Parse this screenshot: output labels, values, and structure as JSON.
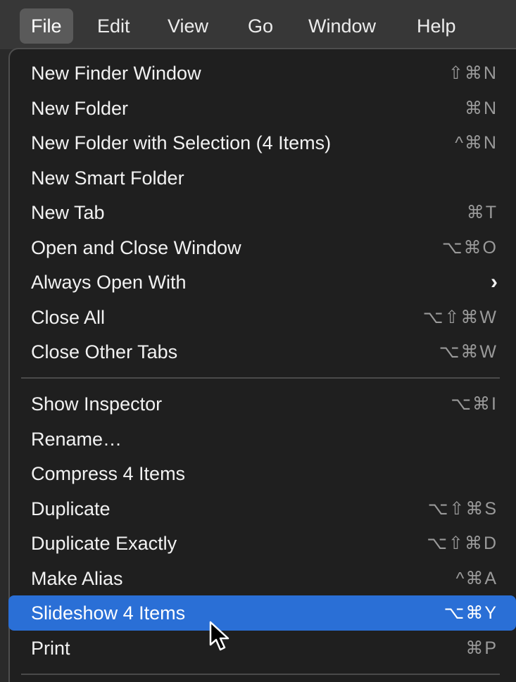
{
  "menubar": {
    "items": [
      {
        "label": "File"
      },
      {
        "label": "Edit"
      },
      {
        "label": "View"
      },
      {
        "label": "Go"
      },
      {
        "label": "Window"
      },
      {
        "label": "Help"
      }
    ]
  },
  "file_menu": {
    "items": [
      {
        "label": "New Finder Window",
        "shortcut": "⇧⌘N"
      },
      {
        "label": "New Folder",
        "shortcut": "⌘N"
      },
      {
        "label": "New Folder with Selection (4 Items)",
        "shortcut": "^⌘N"
      },
      {
        "label": "New Smart Folder",
        "shortcut": ""
      },
      {
        "label": "New Tab",
        "shortcut": "⌘T"
      },
      {
        "label": "Open and Close Window",
        "shortcut": "⌥⌘O"
      },
      {
        "label": "Always Open With",
        "shortcut": ""
      },
      {
        "label": "Close All",
        "shortcut": "⌥⇧⌘W"
      },
      {
        "label": "Close Other Tabs",
        "shortcut": "⌥⌘W"
      },
      {
        "label": "Show Inspector",
        "shortcut": "⌥⌘I"
      },
      {
        "label": "Rename…",
        "shortcut": ""
      },
      {
        "label": "Compress 4 Items",
        "shortcut": ""
      },
      {
        "label": "Duplicate",
        "shortcut": "⌥⇧⌘S"
      },
      {
        "label": "Duplicate Exactly",
        "shortcut": "⌥⇧⌘D"
      },
      {
        "label": "Make Alias",
        "shortcut": "^⌘A"
      },
      {
        "label": "Slideshow 4 Items",
        "shortcut": "⌥⌘Y"
      },
      {
        "label": "Print",
        "shortcut": "⌘P"
      }
    ],
    "highlighted_item": "Slideshow 4 Items",
    "submenu_icon": "chevron-right-icon"
  },
  "colors": {
    "highlight": "#2a6fd6",
    "menu_background": "#1f1f1f",
    "menubar_background": "#373737"
  }
}
